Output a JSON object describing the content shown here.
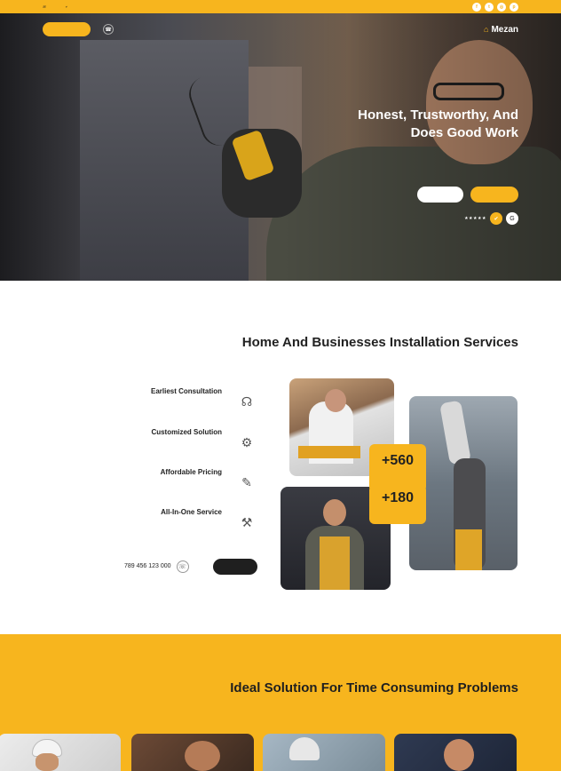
{
  "colors": {
    "accent": "#f7b51e",
    "dark": "#1f1f1f"
  },
  "topbar": {
    "email_icon": "envelope-icon",
    "location_icon": "map-pin-icon",
    "socials": [
      {
        "icon": "facebook-icon",
        "glyph": "f"
      },
      {
        "icon": "twitter-icon",
        "glyph": "t"
      },
      {
        "icon": "instagram-icon",
        "glyph": "◎"
      },
      {
        "icon": "pinterest-icon",
        "glyph": "p"
      }
    ]
  },
  "nav": {
    "logo": "Mezan",
    "logo_icon": "house-wrench-icon"
  },
  "hero": {
    "title": "Honest, Trustworthy, And Does Good Work",
    "rating_stars": "★★★★★"
  },
  "section2": {
    "title": "Home And Businesses Installation Services",
    "features": [
      {
        "title": "Earliest Consultation",
        "icon": "consultation-icon",
        "glyph": "☊"
      },
      {
        "title": "Customized Solution",
        "icon": "document-settings-icon",
        "glyph": "⚙"
      },
      {
        "title": "Affordable Pricing",
        "icon": "price-tag-icon",
        "glyph": "✎"
      },
      {
        "title": "All-In-One Service",
        "icon": "toolbox-icon",
        "glyph": "⚒"
      }
    ],
    "contact_number": "789 456 123 000",
    "phone_icon": "phone-icon",
    "stats": [
      {
        "value": "+560"
      },
      {
        "value": "+180"
      }
    ]
  },
  "section3": {
    "title": "Ideal Solution For Time Consuming Problems"
  }
}
